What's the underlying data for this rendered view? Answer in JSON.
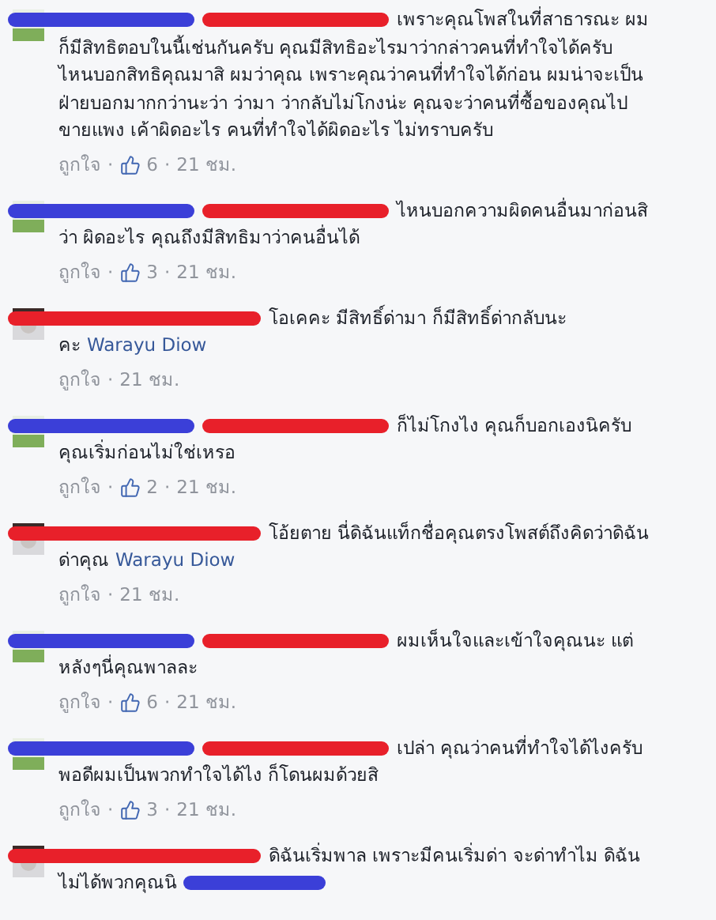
{
  "separator": "·",
  "comments": [
    {
      "avatar": {
        "kind": "landscape"
      },
      "redactions": [
        {
          "color": "#3b3fd8"
        },
        {
          "color": "#e8202a"
        }
      ],
      "body": [
        {
          "kind": "text",
          "text": "เพราะคุณโพสในที่สาธารณะ ผมก็มีสิทธิตอบในนี้เช่นกันครับ คุณมีสิทธิอะไรมาว่ากล่าวคนที่ทำใจได้ครับ ไหนบอกสิทธิคุณมาสิ ผมว่าคุณ เพราะคุณว่าคนที่ทำใจได้ก่อน ผมน่าจะเป็นฝ่ายบอกมากกว่านะว่า ว่ามา ว่ากลับไม่โกงน่ะ คุณจะว่าคนที่ซื้อของคุณไปขายแพง เค้าผิดอะไร คนที่ทำใจได้ผิดอะไร ไม่ทราบครับ"
        }
      ],
      "like": "ถูกใจ",
      "likes": "6",
      "time": "21 ชม."
    },
    {
      "avatar": {
        "kind": "landscape"
      },
      "redactions": [
        {
          "color": "#3b3fd8"
        },
        {
          "color": "#e8202a"
        }
      ],
      "body": [
        {
          "kind": "text",
          "text": "ไหนบอกความผิดคนอื่นมาก่อนสิว่า ผิดอะไร คุณถึงมีสิทธิมาว่าคนอื่นได้"
        }
      ],
      "like": "ถูกใจ",
      "likes": "3",
      "time": "21 ชม."
    },
    {
      "avatar": {
        "kind": "portrait"
      },
      "redactions": [
        {
          "color": "#e8202a"
        }
      ],
      "body": [
        {
          "kind": "text",
          "text": "โอเคคะ มีสิทธิ์ด่ามา ก็มีสิทธิ์ด่ากลับนะคะ"
        },
        {
          "kind": "link",
          "text": "Warayu Diow"
        }
      ],
      "like": "ถูกใจ",
      "time": "21 ชม."
    },
    {
      "avatar": {
        "kind": "landscape"
      },
      "redactions": [
        {
          "color": "#3b3fd8"
        },
        {
          "color": "#e8202a"
        }
      ],
      "body": [
        {
          "kind": "text",
          "text": "ก็ไม่โกงไง คุณก็บอกเองนิครับ คุณเริ่มก่อนไม่ใช่เหรอ"
        }
      ],
      "like": "ถูกใจ",
      "likes": "2",
      "time": "21 ชม."
    },
    {
      "avatar": {
        "kind": "portrait"
      },
      "redactions": [
        {
          "color": "#e8202a"
        }
      ],
      "body": [
        {
          "kind": "text",
          "text": "โอ้ยตาย นี่ดิฉันแท็กชื่อคุณตรงโพสต์ถึงคิดว่าดิฉันด่าคุณ"
        },
        {
          "kind": "link",
          "text": "Warayu Diow"
        }
      ],
      "like": "ถูกใจ",
      "time": "21 ชม."
    },
    {
      "avatar": {
        "kind": "landscape"
      },
      "redactions": [
        {
          "color": "#3b3fd8"
        },
        {
          "color": "#e8202a"
        }
      ],
      "body": [
        {
          "kind": "text",
          "text": "ผมเห็นใจและเข้าใจคุณนะ แต่หลังๆนี่คุณพาลละ"
        }
      ],
      "like": "ถูกใจ",
      "likes": "6",
      "time": "21 ชม."
    },
    {
      "avatar": {
        "kind": "landscape"
      },
      "redactions": [
        {
          "color": "#3b3fd8"
        },
        {
          "color": "#e8202a"
        }
      ],
      "body": [
        {
          "kind": "text",
          "text": "เปล่า คุณว่าคนที่ทำใจได้ไงครับ พอดีผมเป็นพวกทำใจได้ไง ก็โดนผมด้วยสิ"
        }
      ],
      "like": "ถูกใจ",
      "likes": "3",
      "time": "21 ชม."
    },
    {
      "avatar": {
        "kind": "portrait"
      },
      "redactions": [
        {
          "color": "#e8202a"
        }
      ],
      "body": [
        {
          "kind": "text",
          "text": "ดิฉันเริ่มพาล เพราะมีคนเริ่มด่า จะด่าทำไม ดิฉันไม่ได้พวกคุณนิ"
        },
        {
          "kind": "redaction",
          "color": "#3b3fd8"
        }
      ]
    }
  ]
}
